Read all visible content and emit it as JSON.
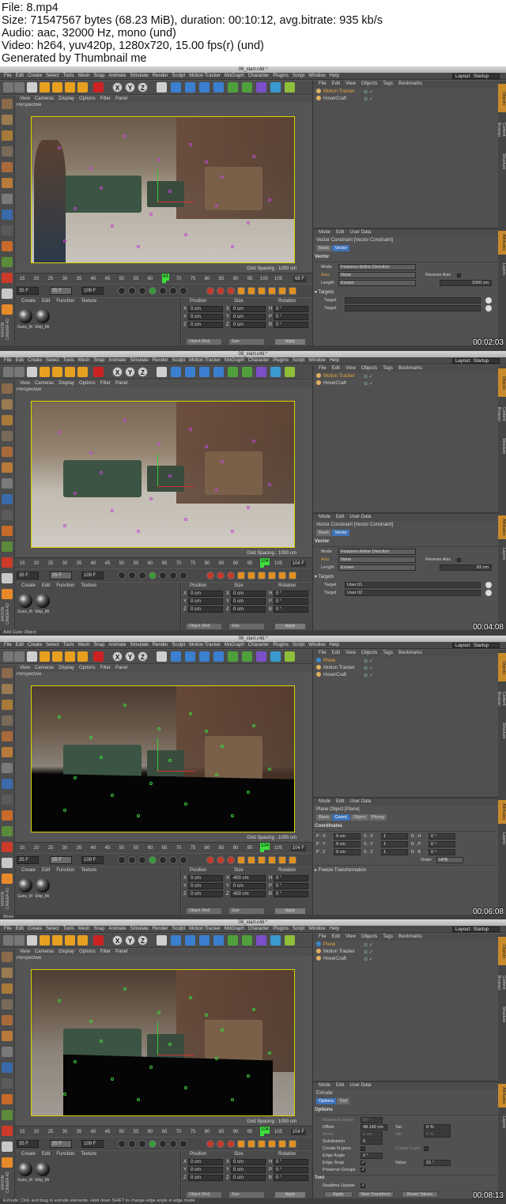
{
  "header": {
    "lines": [
      "File: 8.mp4",
      "Size: 71547567 bytes (68.23 MiB), duration: 00:10:12, avg.bitrate: 935 kb/s",
      "Audio: aac, 32000 Hz, mono (und)",
      "Video: h264, yuv420p, 1280x720, 15.00 fps(r) (und)",
      "Generated by Thumbnail me"
    ]
  },
  "app": {
    "menu": [
      "File",
      "Edit",
      "Create",
      "Select",
      "Tools",
      "Mesh",
      "Snap",
      "Animate",
      "Simulate",
      "Render",
      "Sculpt",
      "Motion Tracker",
      "MoGraph",
      "Character",
      "Plugins",
      "Script",
      "Window",
      "Help"
    ],
    "layout_label": "Layout:",
    "layout_value": "Startup",
    "viewport_menu": [
      "View",
      "Cameras",
      "Display",
      "Options",
      "Filter",
      "Panel"
    ],
    "viewport_label": "Perspective",
    "grid_spacing": "Grid Spacing : 1000 cm",
    "timeline_ticks": [
      "15",
      "20",
      "25",
      "30",
      "35",
      "40",
      "45",
      "50",
      "55",
      "60",
      "65",
      "70",
      "75",
      "80",
      "85",
      "90",
      "95",
      "100",
      "105"
    ],
    "material_menu": [
      "Create",
      "Edit",
      "Function",
      "Texture"
    ],
    "materials": [
      "Guns_M",
      "Ship_Mi"
    ],
    "coord_heads": [
      "Position",
      "Size",
      "Rotation"
    ],
    "axis_letters": [
      "X",
      "Y",
      "Z"
    ],
    "rot_letters": [
      "H",
      "P",
      "B"
    ],
    "object_menu": [
      "File",
      "Edit",
      "View",
      "Objects",
      "Tags",
      "Bookmarks"
    ],
    "attr_menu": [
      "Mode",
      "Edit",
      "User Data"
    ],
    "apply": "Apply",
    "object_rel": "Object (Rel)",
    "size_label": "Size",
    "maxon": "MAXON CINEMA 4D",
    "right_tabs": [
      "Objects",
      "Content Browser",
      "Structure"
    ],
    "right_tabs2": [
      "Attributes",
      "Layers"
    ]
  },
  "frames": [
    {
      "title": "08_start.c4d *",
      "timestamp": "00:02:03",
      "status": "",
      "objects": [
        {
          "name": "Motion Tracker",
          "selected": true
        },
        {
          "name": "HoverCraft",
          "selected": false
        }
      ],
      "play": {
        "start": "35 F",
        "mid": "35 F",
        "end": "109 F",
        "cur": "68",
        "endtl": "68 F"
      },
      "coords": {
        "px": "0 cm",
        "py": "0 cm",
        "pz": "0 cm",
        "sx": "0 cm",
        "sy": "0 cm",
        "sz": "0 cm",
        "rh": "0 °",
        "rp": "0 °",
        "rb": "0 °"
      },
      "attr": {
        "title": "Vector Constraint [Vector Constraint]",
        "tabs": [
          {
            "label": "Basic",
            "on": false
          },
          {
            "label": "Vector",
            "on": true
          }
        ],
        "section": "Vector",
        "mode_label": "Mode",
        "mode_value": "Features define Direction",
        "axis_label": "Axis",
        "axis_value": "None",
        "reverse_label": "Reverse Axis",
        "length_label": "Length",
        "length_value": "Known",
        "length_num": "1000 cm",
        "targets_label": "▾ Targets",
        "target_label": "Target",
        "target1": "",
        "target2": ""
      }
    },
    {
      "title": "08_start.c4d *",
      "timestamp": "00:04:08",
      "status": "Add Cube Object",
      "objects": [
        {
          "name": "Motion Tracker",
          "selected": true
        },
        {
          "name": "HoverCraft",
          "selected": false
        }
      ],
      "play": {
        "start": "35 F",
        "mid": "35 F",
        "end": "109 F",
        "cur": "104",
        "endtl": "104 F"
      },
      "coords": {
        "px": "0 cm",
        "py": "0 cm",
        "pz": "0 cm",
        "sx": "0 cm",
        "sy": "0 cm",
        "sz": "0 cm",
        "rh": "0 °",
        "rp": "0 °",
        "rb": "0 °"
      },
      "attr": {
        "title": "Vector Constraint [Vector Constraint]",
        "tabs": [
          {
            "label": "Basic",
            "on": false
          },
          {
            "label": "Vector",
            "on": true
          }
        ],
        "section": "Vector",
        "mode_label": "Mode",
        "mode_value": "Features define Direction",
        "axis_label": "Axis",
        "axis_value": "None",
        "reverse_label": "Reverse Axis",
        "length_label": "Length",
        "length_value": "Known",
        "length_num": "82 cm",
        "targets_label": "▾ Targets",
        "target_label": "Target",
        "target1": "User 01",
        "target2": "User 02"
      }
    },
    {
      "title": "08_start.c4d *",
      "timestamp": "00:06:08",
      "status": "Move",
      "objects": [
        {
          "name": "Plane",
          "selected": true
        },
        {
          "name": "Motion Tracker",
          "selected": false
        },
        {
          "name": "HoverCraft",
          "selected": false
        }
      ],
      "play": {
        "start": "35 F",
        "mid": "35 F",
        "end": "109 F",
        "cur": "104",
        "endtl": "104 F"
      },
      "coords": {
        "px": "0 cm",
        "py": "0 cm",
        "pz": "0 cm",
        "sx": "400 cm",
        "sy": "0 cm",
        "sz": "400 cm",
        "rh": "0 °",
        "rp": "0 °",
        "rb": "0 °"
      },
      "plane": {
        "title": "Plane Object [Plane]",
        "tabs": [
          {
            "label": "Basic",
            "on": false
          },
          {
            "label": "Coord.",
            "on": true
          },
          {
            "label": "Object",
            "on": false
          },
          {
            "label": "Phong",
            "on": false
          }
        ],
        "section": "Coordinates",
        "rows": [
          {
            "p": "P . X",
            "pv": "0 cm",
            "s": "S . X",
            "sv": "1",
            "r": "R . H",
            "rv": "0 °"
          },
          {
            "p": "P . Y",
            "pv": "0 cm",
            "s": "S . Y",
            "sv": "1",
            "r": "R . P",
            "rv": "0 °"
          },
          {
            "p": "P . Z",
            "pv": "0 cm",
            "s": "S . Z",
            "sv": "1",
            "r": "R . B",
            "rv": "0 °"
          }
        ],
        "order_label": "Order",
        "order_value": "HPB",
        "freeze": "▸ Freeze Transformation"
      }
    },
    {
      "title": "08_start.c4d *",
      "timestamp": "00:08:13",
      "status": "Extrude: Click and drag to extrude elements. Hold down SHIFT to change edge angle in edge mode",
      "objects": [
        {
          "name": "Plane",
          "selected": true
        },
        {
          "name": "Motion Tracker",
          "selected": false
        },
        {
          "name": "HoverCraft",
          "selected": false
        }
      ],
      "play": {
        "start": "35 F",
        "mid": "35 F",
        "end": "109 F",
        "cur": "104",
        "endtl": "104 F"
      },
      "coords": {
        "px": "0 cm",
        "py": "0 cm",
        "pz": "0 cm",
        "sx": "0 cm",
        "sy": "0 cm",
        "sz": "0 cm",
        "rh": "0 °",
        "rp": "0 °",
        "rb": "0 °"
      },
      "extrude": {
        "title": "Extrude",
        "tabs": [
          {
            "label": "Options",
            "on": true
          },
          {
            "label": "Tool",
            "on": false
          }
        ],
        "section": "Options",
        "max_angle_label": "Maximum Angle",
        "max_angle": "89 °",
        "offset_label": "Offset",
        "offset": "48.142 cm",
        "var_label": "Var.",
        "var1": "0 %",
        "bevel_label": "Bevel",
        "bevel": "5 cm",
        "var2": "0 %",
        "subdiv_label": "Subdivision",
        "subdiv": "0",
        "ngons_label": "Create N-gons",
        "caps_label": "Create Caps",
        "edge_angle_label": "Edge Angle",
        "edge_angle": "0 °",
        "edge_snap_label": "Edge Snap",
        "value_label": "Value",
        "value": "15 °",
        "preserve_label": "Preserve Groups",
        "tool_section": "Tool",
        "realtime_label": "Realtime Update",
        "btn_apply": "Apply",
        "btn_new": "New Transform",
        "btn_reset": "Reset Values"
      }
    }
  ]
}
